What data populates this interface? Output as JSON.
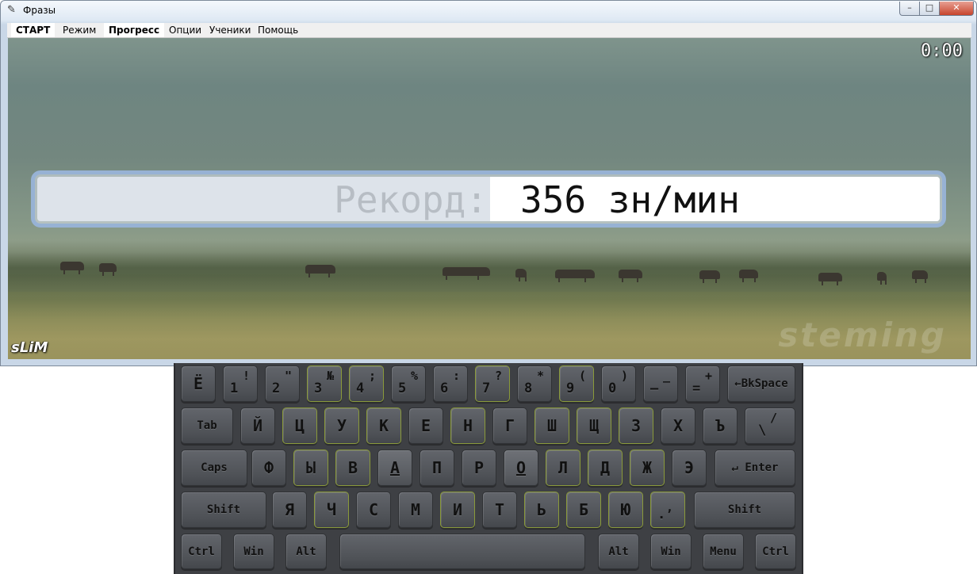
{
  "window": {
    "title": "Фразы",
    "min": "–",
    "max": "□",
    "close": "✕"
  },
  "menu": [
    "СТАРТ",
    "Режим",
    "Прогресс",
    "Опции",
    "Ученики",
    "Помощь"
  ],
  "timer": "0:00",
  "record": {
    "label": "Рекорд:",
    "value": "356 зн/мин"
  },
  "logo": "sLiM",
  "watermark": "steming",
  "keyboard": {
    "row1": [
      {
        "m": "Ё"
      },
      {
        "m": "1",
        "t": "!"
      },
      {
        "m": "2",
        "t": "\""
      },
      {
        "m": "3",
        "t": "№"
      },
      {
        "m": "4",
        "t": ";"
      },
      {
        "m": "5",
        "t": "%"
      },
      {
        "m": "6",
        "t": ":"
      },
      {
        "m": "7",
        "t": "?"
      },
      {
        "m": "8",
        "t": "*"
      },
      {
        "m": "9",
        "t": "("
      },
      {
        "m": "0",
        "t": ")"
      },
      {
        "m": "–",
        "t": "_"
      },
      {
        "m": "=",
        "t": "+"
      },
      {
        "m": "←BkSpace"
      }
    ],
    "row2": [
      {
        "m": "Tab"
      },
      {
        "m": "Й"
      },
      {
        "m": "Ц"
      },
      {
        "m": "У"
      },
      {
        "m": "К"
      },
      {
        "m": "Е"
      },
      {
        "m": "Н"
      },
      {
        "m": "Г"
      },
      {
        "m": "Ш"
      },
      {
        "m": "Щ"
      },
      {
        "m": "З"
      },
      {
        "m": "Х"
      },
      {
        "m": "Ъ"
      },
      {
        "m": "\\",
        "t": "/"
      }
    ],
    "row3": [
      {
        "m": "Caps"
      },
      {
        "m": "Ф"
      },
      {
        "m": "Ы"
      },
      {
        "m": "В"
      },
      {
        "m": "А"
      },
      {
        "m": "П"
      },
      {
        "m": "Р"
      },
      {
        "m": "О"
      },
      {
        "m": "Л"
      },
      {
        "m": "Д"
      },
      {
        "m": "Ж"
      },
      {
        "m": "Э"
      },
      {
        "m": "↵ Enter"
      }
    ],
    "row4": [
      {
        "m": "Shift"
      },
      {
        "m": "Я"
      },
      {
        "m": "Ч"
      },
      {
        "m": "С"
      },
      {
        "m": "М"
      },
      {
        "m": "И"
      },
      {
        "m": "Т"
      },
      {
        "m": "Ь"
      },
      {
        "m": "Б"
      },
      {
        "m": "Ю"
      },
      {
        "m": ".",
        "t": ","
      },
      {
        "m": "Shift"
      }
    ],
    "row5": [
      {
        "m": "Ctrl"
      },
      {
        "m": "Win"
      },
      {
        "m": "Alt"
      },
      {
        "m": ""
      },
      {
        "m": "Alt"
      },
      {
        "m": "Win"
      },
      {
        "m": "Menu"
      },
      {
        "m": "Ctrl"
      }
    ]
  }
}
